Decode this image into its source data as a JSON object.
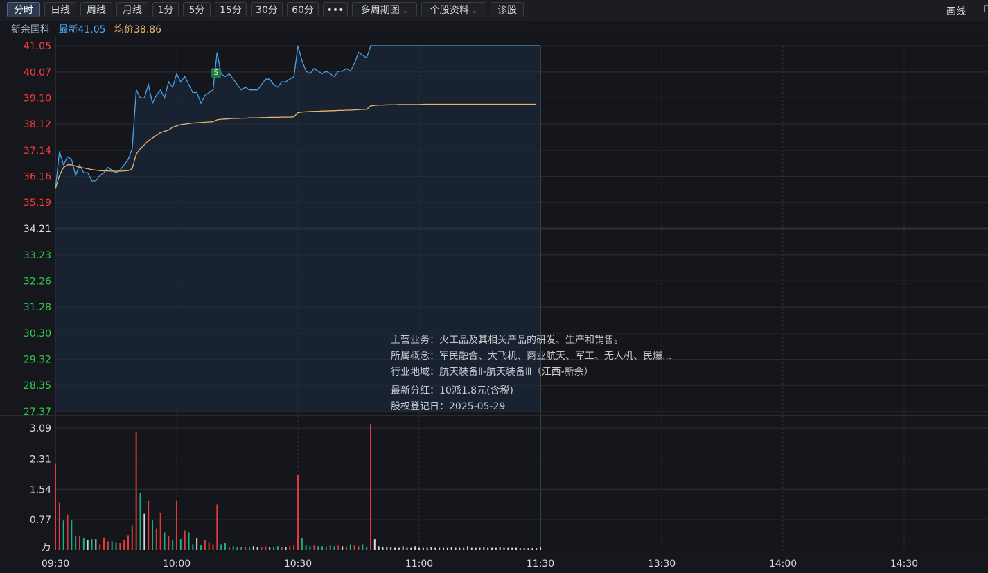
{
  "toolbar": {
    "buttons": [
      {
        "label": "分时",
        "active": true
      },
      {
        "label": "日线",
        "active": false
      },
      {
        "label": "周线",
        "active": false
      },
      {
        "label": "月线",
        "active": false
      },
      {
        "label": "1分",
        "active": false
      },
      {
        "label": "5分",
        "active": false
      },
      {
        "label": "15分",
        "active": false
      },
      {
        "label": "30分",
        "active": false
      },
      {
        "label": "60分",
        "active": false
      },
      {
        "label": "•••",
        "active": false
      },
      {
        "label": "多周期图",
        "active": false,
        "dropdown": true
      },
      {
        "label": "个股资料",
        "active": false,
        "dropdown": true
      },
      {
        "label": "诊股",
        "active": false
      }
    ],
    "draw_line": "画线",
    "corner": "Γ"
  },
  "info": {
    "name": "新余国科",
    "latest_label": "最新41.05",
    "avg_label": "均价38.86"
  },
  "marker": {
    "label": "S"
  },
  "tooltip": {
    "business": "主营业务：火工品及其相关产品的研发、生产和销售。",
    "concepts": "所属概念：军民融合、大飞机、商业航天、军工、无人机、民爆...",
    "industry": "行业地域：航天装备Ⅱ-航天装备Ⅲ（江西-新余）",
    "dividend": "最新分红：10派1.8元(含税)",
    "record_date": "股权登记日：2025-05-29"
  },
  "colors": {
    "price_line": "#4aa3e8",
    "avg_line": "#e8b36a",
    "up": "#e03a3a",
    "down": "#16b088",
    "flat": "#d6d8dd",
    "grid": "#2e3037",
    "up_text": "#ff3b3b",
    "down_text": "#2ecc4a",
    "neutral_text": "#d6d8dd"
  },
  "chart_data": {
    "type": "line",
    "price_ticks": [
      "41.05",
      "40.07",
      "39.10",
      "38.12",
      "37.14",
      "36.16",
      "35.19",
      "34.21",
      "33.23",
      "32.26",
      "31.28",
      "30.30",
      "29.32",
      "28.35",
      "27.37"
    ],
    "ylim": [
      27.37,
      41.05
    ],
    "prev_close": 34.21,
    "time_ticks": [
      "09:30",
      "10:00",
      "10:30",
      "11:00",
      "11:30",
      "13:30",
      "14:00",
      "14:30"
    ],
    "volume_ticks": [
      "3.09",
      "2.31",
      "1.54",
      "0.77",
      "万"
    ],
    "volume_ylim": [
      0,
      3.09
    ],
    "series": [
      {
        "key": "price",
        "values": [
          35.7,
          37.1,
          36.6,
          36.9,
          36.8,
          36.2,
          36.6,
          36.3,
          36.3,
          36.0,
          36.0,
          36.2,
          36.3,
          36.5,
          36.4,
          36.3,
          36.4,
          36.6,
          36.8,
          37.2,
          39.4,
          39.1,
          39.1,
          39.6,
          38.9,
          39.2,
          39.4,
          39.1,
          39.7,
          39.5,
          40.0,
          39.7,
          39.9,
          39.6,
          39.3,
          39.3,
          38.9,
          39.2,
          39.3,
          39.4,
          40.8,
          40.0,
          39.9,
          40.0,
          39.8,
          39.6,
          39.4,
          39.5,
          39.4,
          39.4,
          39.4,
          39.6,
          39.8,
          39.8,
          39.6,
          39.5,
          39.7,
          39.7,
          39.8,
          39.9,
          41.05,
          40.5,
          40.1,
          40.0,
          40.2,
          40.1,
          40.0,
          40.1,
          40.0,
          39.9,
          40.1,
          40.1,
          40.2,
          40.1,
          40.4,
          40.8,
          40.7,
          40.6,
          41.05,
          41.05,
          41.05,
          41.05,
          41.05,
          41.05,
          41.05,
          41.05,
          41.05,
          41.05,
          41.05,
          41.05,
          41.05,
          41.05,
          41.05,
          41.05,
          41.05,
          41.05,
          41.05,
          41.05,
          41.05,
          41.05,
          41.05,
          41.05,
          41.05,
          41.05,
          41.05,
          41.05,
          41.05,
          41.05,
          41.05,
          41.05,
          41.05,
          41.05,
          41.05,
          41.05,
          41.05,
          41.05,
          41.05,
          41.05,
          41.05,
          41.05,
          41.05
        ]
      },
      {
        "key": "avg",
        "values": [
          35.7,
          36.2,
          36.5,
          36.6,
          36.6,
          36.55,
          36.5,
          36.48,
          36.45,
          36.42,
          36.4,
          36.38,
          36.37,
          36.37,
          36.36,
          36.36,
          36.36,
          36.37,
          36.38,
          36.45,
          37.0,
          37.2,
          37.35,
          37.5,
          37.6,
          37.7,
          37.8,
          37.85,
          37.9,
          38.0,
          38.05,
          38.1,
          38.12,
          38.14,
          38.16,
          38.17,
          38.18,
          38.19,
          38.2,
          38.21,
          38.28,
          38.3,
          38.31,
          38.32,
          38.33,
          38.33,
          38.34,
          38.34,
          38.35,
          38.35,
          38.35,
          38.36,
          38.36,
          38.37,
          38.37,
          38.37,
          38.38,
          38.38,
          38.38,
          38.39,
          38.55,
          38.57,
          38.58,
          38.59,
          38.6,
          38.6,
          38.61,
          38.61,
          38.62,
          38.62,
          38.63,
          38.63,
          38.64,
          38.64,
          38.65,
          38.66,
          38.67,
          38.67,
          38.8,
          38.82,
          38.83,
          38.83,
          38.84,
          38.84,
          38.84,
          38.85,
          38.85,
          38.85,
          38.85,
          38.85,
          38.85,
          38.86,
          38.86,
          38.86,
          38.86,
          38.86,
          38.86,
          38.86,
          38.86,
          38.86,
          38.86,
          38.86,
          38.86,
          38.86,
          38.86,
          38.86,
          38.86,
          38.86,
          38.86,
          38.86,
          38.86,
          38.86,
          38.86,
          38.86,
          38.86,
          38.86,
          38.86,
          38.86,
          38.86,
          38.86
        ]
      },
      {
        "key": "volume",
        "values": [
          2.2,
          1.2,
          0.75,
          0.9,
          0.75,
          0.35,
          0.35,
          0.3,
          0.25,
          0.28,
          0.28,
          0.15,
          0.32,
          0.22,
          0.22,
          0.2,
          0.18,
          0.25,
          0.38,
          0.62,
          3.0,
          1.45,
          0.92,
          1.25,
          0.75,
          0.55,
          0.95,
          0.45,
          0.35,
          0.25,
          1.25,
          0.28,
          0.5,
          0.45,
          0.15,
          0.3,
          0.12,
          0.25,
          0.2,
          0.15,
          1.15,
          0.15,
          0.18,
          0.08,
          0.1,
          0.08,
          0.08,
          0.09,
          0.08,
          0.1,
          0.08,
          0.08,
          0.1,
          0.08,
          0.08,
          0.1,
          0.08,
          0.08,
          0.1,
          0.12,
          1.9,
          0.3,
          0.12,
          0.1,
          0.12,
          0.1,
          0.1,
          0.08,
          0.12,
          0.1,
          0.12,
          0.1,
          0.08,
          0.15,
          0.12,
          0.1,
          0.15,
          0.08,
          3.2,
          0.28,
          0.1,
          0.08,
          0.08,
          0.08,
          0.06,
          0.06,
          0.1,
          0.06,
          0.06,
          0.1,
          0.06,
          0.06,
          0.06,
          0.08,
          0.06,
          0.06,
          0.06,
          0.06,
          0.08,
          0.06,
          0.06,
          0.06,
          0.1,
          0.06,
          0.06,
          0.06,
          0.08,
          0.06,
          0.06,
          0.06,
          0.08,
          0.06,
          0.06,
          0.06,
          0.06,
          0.05,
          0.05,
          0.05,
          0.05,
          0.05,
          0.08
        ]
      }
    ]
  }
}
